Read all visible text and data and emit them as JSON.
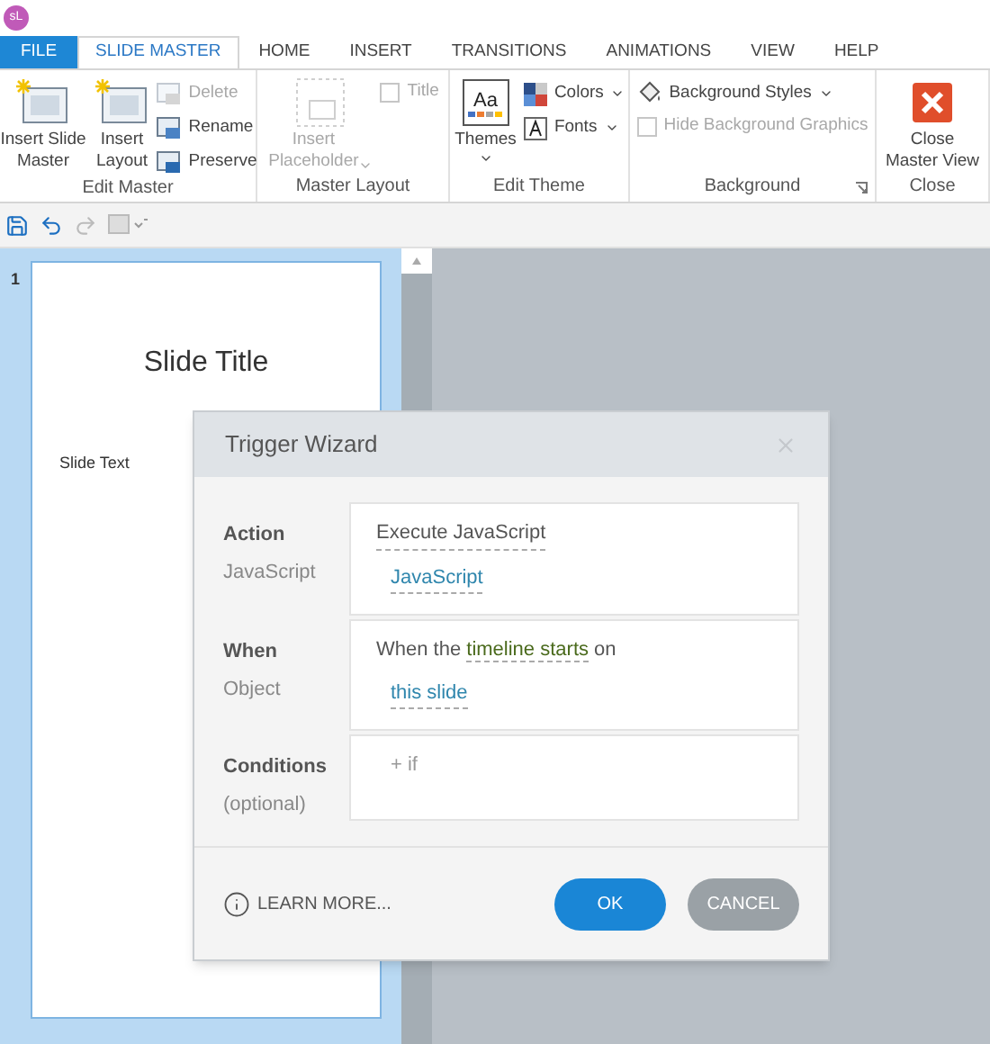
{
  "app_badge": "sL",
  "tabs": [
    {
      "label": "FILE",
      "kind": "file",
      "selected": false
    },
    {
      "label": "SLIDE MASTER",
      "kind": "tab",
      "selected": true
    },
    {
      "label": "HOME",
      "kind": "tab",
      "selected": false
    },
    {
      "label": "INSERT",
      "kind": "tab",
      "selected": false
    },
    {
      "label": "TRANSITIONS",
      "kind": "tab",
      "selected": false
    },
    {
      "label": "ANIMATIONS",
      "kind": "tab",
      "selected": false
    },
    {
      "label": "VIEW",
      "kind": "tab",
      "selected": false
    },
    {
      "label": "HELP",
      "kind": "tab",
      "selected": false
    }
  ],
  "ribbon": {
    "groups": [
      {
        "label": "Edit Master",
        "launcher": false,
        "items": [
          {
            "label": "Insert Slide\nMaster",
            "kind": "large",
            "disabled": false,
            "dropdown": false
          },
          {
            "label": "Insert\nLayout",
            "kind": "large",
            "disabled": false,
            "dropdown": false
          },
          {
            "label": "Delete",
            "kind": "small",
            "disabled": true,
            "dropdown": false
          },
          {
            "label": "Rename",
            "kind": "small",
            "disabled": false,
            "dropdown": false
          },
          {
            "label": "Preserve",
            "kind": "small",
            "disabled": false,
            "dropdown": false
          }
        ]
      },
      {
        "label": "Master Layout",
        "launcher": false,
        "items": [
          {
            "label": "Insert\nPlaceholder",
            "kind": "large",
            "disabled": true,
            "dropdown": true
          },
          {
            "label": "Title",
            "kind": "checkbox",
            "disabled": true,
            "checked": false
          }
        ]
      },
      {
        "label": "Edit Theme",
        "launcher": false,
        "items": [
          {
            "label": "Themes",
            "kind": "large",
            "disabled": false,
            "dropdown": true,
            "sample": "Aa"
          },
          {
            "label": "Colors",
            "kind": "small",
            "disabled": false,
            "dropdown": true
          },
          {
            "label": "Fonts",
            "kind": "small",
            "disabled": false,
            "dropdown": true
          }
        ]
      },
      {
        "label": "Background",
        "launcher": true,
        "items": [
          {
            "label": "Background Styles",
            "kind": "small",
            "disabled": false,
            "dropdown": true
          },
          {
            "label": "Hide Background Graphics",
            "kind": "checkbox",
            "disabled": true,
            "checked": false
          }
        ]
      },
      {
        "label": "Close",
        "launcher": false,
        "items": [
          {
            "label": "Close\nMaster View",
            "kind": "large",
            "disabled": false,
            "dropdown": false
          }
        ]
      }
    ]
  },
  "slides": [
    {
      "number": "1",
      "title": "Slide Title",
      "text": "Slide Text",
      "selected": true
    }
  ],
  "dialog": {
    "title": "Trigger Wizard",
    "rows": [
      {
        "label": "Action",
        "sublabel": "JavaScript",
        "lines": [
          [
            {
              "text": "Execute JavaScript",
              "kind": "action"
            }
          ],
          [
            {
              "text": "JavaScript",
              "kind": "link"
            }
          ]
        ]
      },
      {
        "label": "When",
        "sublabel": "Object",
        "lines": [
          [
            {
              "text": "When the ",
              "kind": "plain"
            },
            {
              "text": "timeline starts",
              "kind": "event"
            },
            {
              "text": " on",
              "kind": "plain"
            }
          ],
          [
            {
              "text": "this slide",
              "kind": "link"
            }
          ]
        ]
      },
      {
        "label": "Conditions",
        "sublabel": "(optional)",
        "lines": [
          [
            {
              "text": "+ if",
              "kind": "add"
            }
          ]
        ]
      }
    ],
    "learn_more": "LEARN MORE...",
    "buttons": [
      {
        "label": "OK",
        "kind": "primary"
      },
      {
        "label": "CANCEL",
        "kind": "secondary"
      }
    ]
  }
}
